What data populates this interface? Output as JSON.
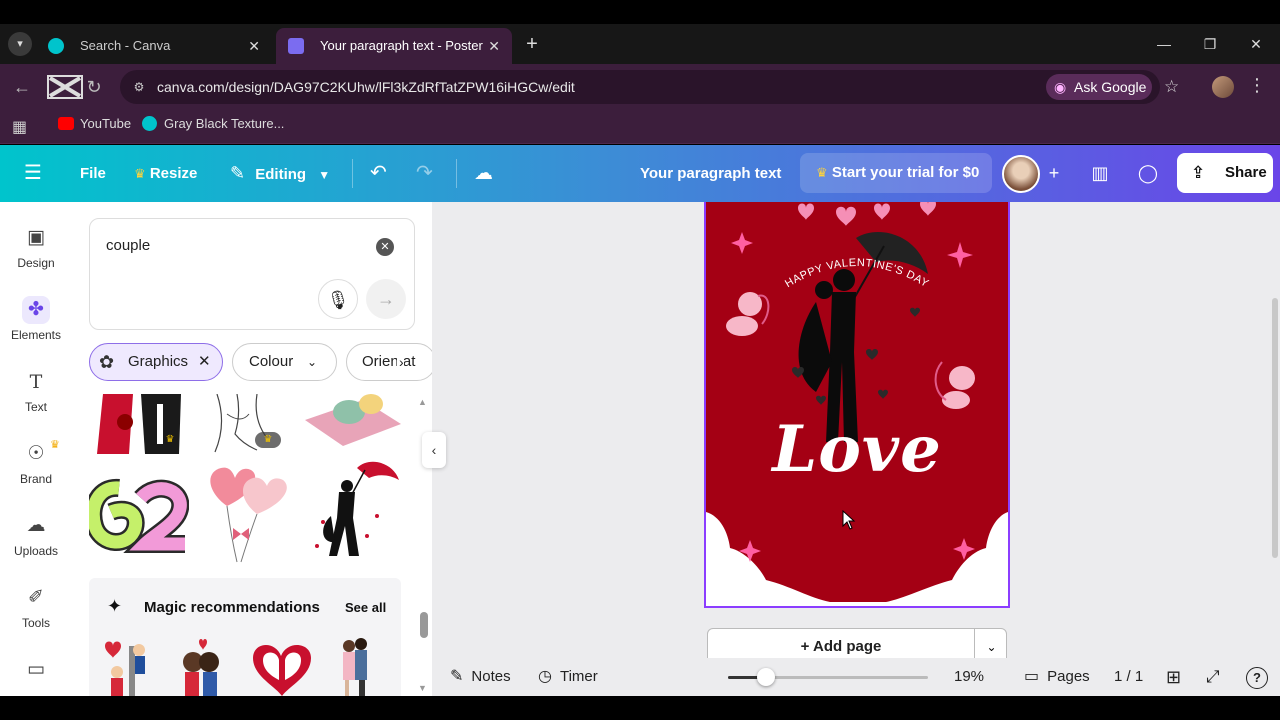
{
  "browser": {
    "tabs": [
      {
        "title": "Search - Canva",
        "active": false
      },
      {
        "title": "Your paragraph text - Poster",
        "active": true
      }
    ],
    "new_tab_icon": "plus-icon",
    "url": "canva.com/design/DAG97C2KUhw/lFl3kZdRfTatZPW16iHGCw/edit",
    "ask_google": "Ask Google",
    "bookmarks": [
      "YouTube",
      "Gray Black Texture..."
    ]
  },
  "header": {
    "file": "File",
    "resize": "Resize",
    "editing": "Editing",
    "doc_title": "Your paragraph text",
    "trial": "Start your trial for $0",
    "share": "Share",
    "gradient": [
      "#00c4cc",
      "#6a45e8"
    ]
  },
  "rail": {
    "items": [
      {
        "label": "Design",
        "icon": "design-icon"
      },
      {
        "label": "Elements",
        "icon": "elements-icon"
      },
      {
        "label": "Text",
        "icon": "text-icon"
      },
      {
        "label": "Brand",
        "icon": "brand-icon"
      },
      {
        "label": "Uploads",
        "icon": "uploads-icon"
      },
      {
        "label": "Tools",
        "icon": "tools-icon"
      },
      {
        "label": "",
        "icon": "projects-icon"
      }
    ],
    "active": "Elements"
  },
  "panel": {
    "search_value": "couple",
    "chips": [
      "Graphics",
      "Colour",
      "Orientat"
    ],
    "magic_title": "Magic recommendations",
    "see_all": "See all"
  },
  "poster": {
    "banner": "HAPPY VALENTINE'S DAY",
    "headline": "Love",
    "background": "#a40014"
  },
  "canvas": {
    "add_page": "+ Add page"
  },
  "bottombar": {
    "notes": "Notes",
    "timer": "Timer",
    "zoom": "19%",
    "zoom_level": 0.19,
    "pages": "Pages",
    "page_count": "1 / 1"
  }
}
